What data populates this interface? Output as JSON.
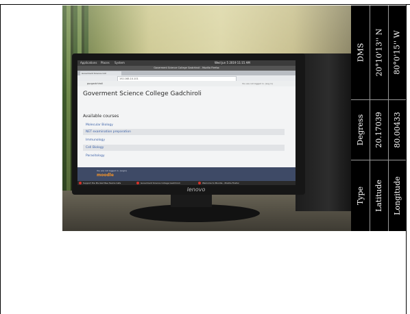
{
  "photo": {
    "os_bar": {
      "left_items": [
        "Applications",
        "Places",
        "System"
      ],
      "clock": "Wed Jun 5 2019 11:15 AM"
    },
    "browser_title": "Goverment Science College Gadchiroli - Mozilla Firefox",
    "tab_label": "Goverment Science Coll",
    "url": "192.168.10.101",
    "site_home": "gscgadchiroli",
    "login_status": "You are not logged in. (Log in)",
    "page_title": "Goverment Science College Gadchiroli",
    "courses_heading": "Available courses",
    "courses": [
      "Molecular Biology",
      "NET examination preparation",
      "Immunology",
      "Cell Biology",
      "Parasitology"
    ],
    "footer_note": "You are not logged in. (Login)",
    "footer_logo": "moodle",
    "taskbar_items": [
      "Support the Plucked Bee Teams Cafe",
      "Goverment Science College Gadchiroli",
      "Welcome to Moodle - Mozilla Firefox"
    ],
    "monitor_brand": "lenovo"
  },
  "coordinates": {
    "headers": [
      "Type",
      "Degress",
      "DMS"
    ],
    "rows": [
      {
        "type": "Latitude",
        "degrees": "20.17039",
        "dms": "20°10'13'' N"
      },
      {
        "type": "Longitude",
        "degrees": "80.00433",
        "dms": "80°0'15'' W"
      }
    ]
  }
}
